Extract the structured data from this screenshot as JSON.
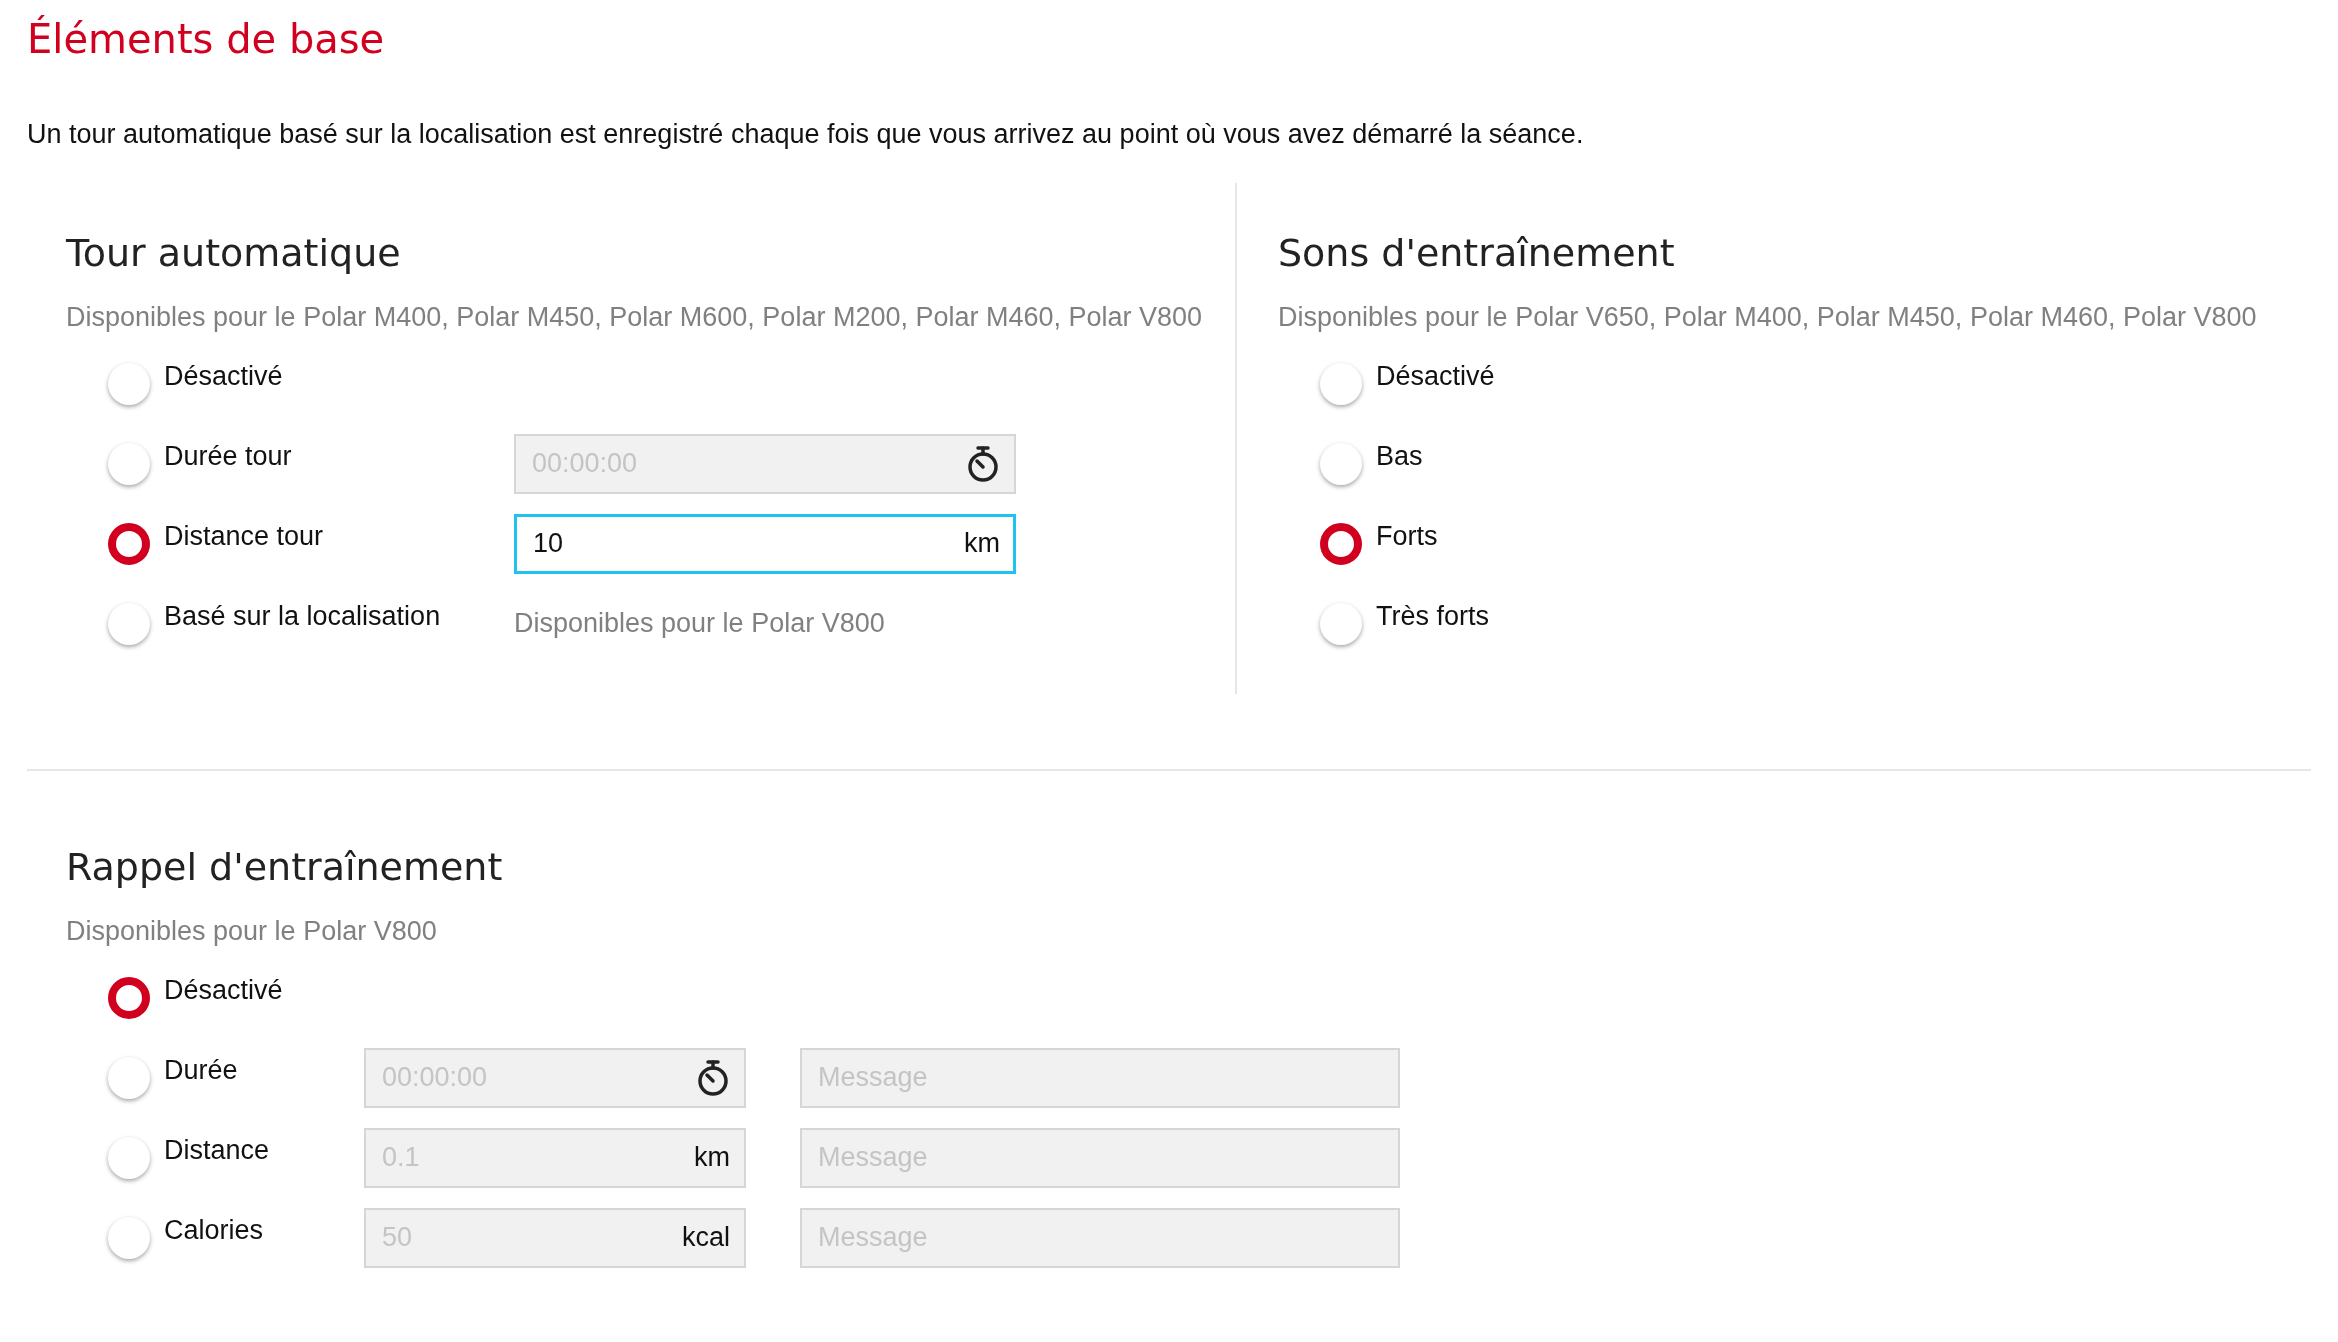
{
  "title": "Éléments de base",
  "intro": "Un tour automatique basé sur la localisation est enregistré chaque fois que vous arrivez au point où vous avez démarré la séance.",
  "auto_lap": {
    "heading": "Tour automatique",
    "availability": "Disponibles pour le Polar M400, Polar M450, Polar M600, Polar M200, Polar M460, Polar V800",
    "options": [
      {
        "label": "Désactivé",
        "selected": false
      },
      {
        "label": "Durée tour",
        "selected": false,
        "field": {
          "kind": "time",
          "placeholder": "00:00:00",
          "disabled": true,
          "focused": false
        }
      },
      {
        "label": "Distance tour",
        "selected": true,
        "field": {
          "kind": "unit",
          "value": "10",
          "unit": "km",
          "disabled": false,
          "focused": true
        }
      },
      {
        "label": "Basé sur la localisation",
        "selected": false,
        "note": "Disponibles pour le Polar V800"
      }
    ]
  },
  "training_sounds": {
    "heading": "Sons d'entraînement",
    "availability": "Disponibles pour le Polar V650, Polar M400, Polar M450, Polar M460, Polar V800",
    "options": [
      {
        "label": "Désactivé",
        "selected": false
      },
      {
        "label": "Bas",
        "selected": false
      },
      {
        "label": "Forts",
        "selected": true
      },
      {
        "label": "Très forts",
        "selected": false
      }
    ]
  },
  "training_reminder": {
    "heading": "Rappel d'entraînement",
    "availability": "Disponibles pour le Polar V800",
    "options": [
      {
        "label": "Désactivé",
        "selected": true
      },
      {
        "label": "Durée",
        "selected": false,
        "field": {
          "kind": "time",
          "placeholder": "00:00:00",
          "disabled": true,
          "focused": false
        },
        "message": {
          "placeholder": "Message",
          "disabled": true
        }
      },
      {
        "label": "Distance",
        "selected": false,
        "field": {
          "kind": "unit",
          "placeholder": "0.1",
          "unit": "km",
          "disabled": true,
          "focused": false
        },
        "message": {
          "placeholder": "Message",
          "disabled": true
        }
      },
      {
        "label": "Calories",
        "selected": false,
        "field": {
          "kind": "unit",
          "placeholder": "50",
          "unit": "kcal",
          "disabled": true,
          "focused": false
        },
        "message": {
          "placeholder": "Message",
          "disabled": true
        }
      }
    ]
  }
}
